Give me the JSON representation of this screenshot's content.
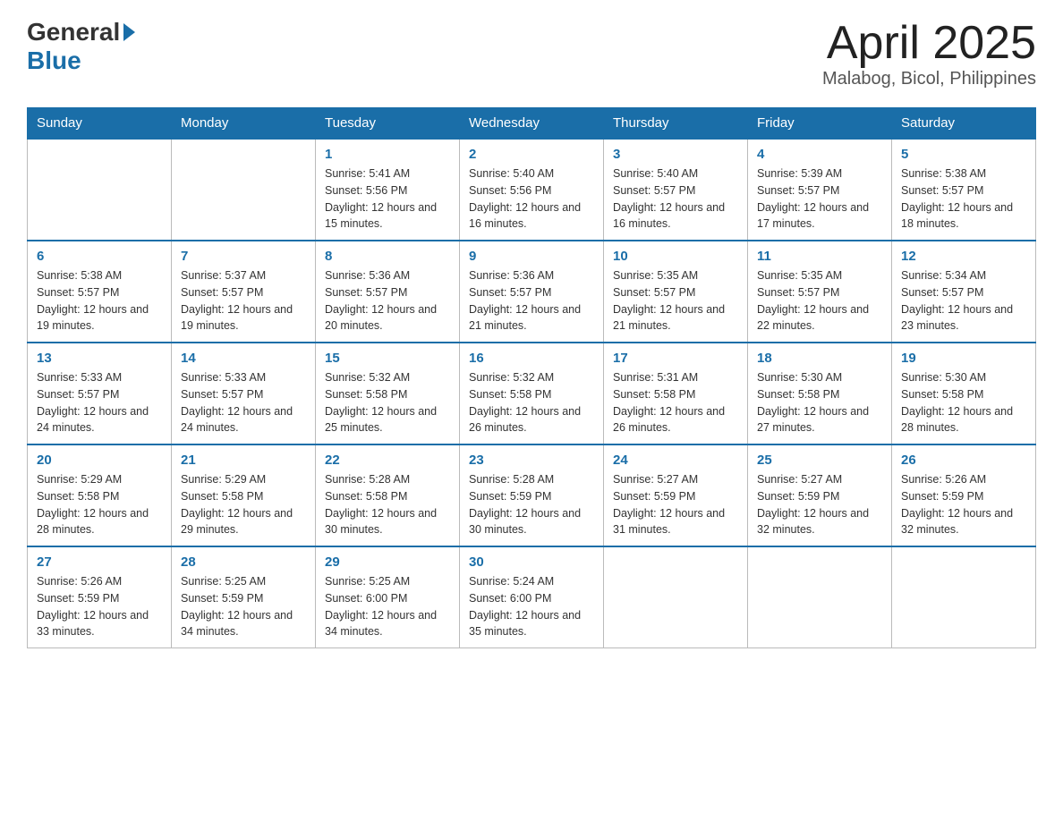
{
  "header": {
    "title": "April 2025",
    "subtitle": "Malabog, Bicol, Philippines",
    "logo_general": "General",
    "logo_blue": "Blue"
  },
  "weekdays": [
    "Sunday",
    "Monday",
    "Tuesday",
    "Wednesday",
    "Thursday",
    "Friday",
    "Saturday"
  ],
  "weeks": [
    [
      {
        "day": "",
        "sunrise": "",
        "sunset": "",
        "daylight": ""
      },
      {
        "day": "",
        "sunrise": "",
        "sunset": "",
        "daylight": ""
      },
      {
        "day": "1",
        "sunrise": "Sunrise: 5:41 AM",
        "sunset": "Sunset: 5:56 PM",
        "daylight": "Daylight: 12 hours and 15 minutes."
      },
      {
        "day": "2",
        "sunrise": "Sunrise: 5:40 AM",
        "sunset": "Sunset: 5:56 PM",
        "daylight": "Daylight: 12 hours and 16 minutes."
      },
      {
        "day": "3",
        "sunrise": "Sunrise: 5:40 AM",
        "sunset": "Sunset: 5:57 PM",
        "daylight": "Daylight: 12 hours and 16 minutes."
      },
      {
        "day": "4",
        "sunrise": "Sunrise: 5:39 AM",
        "sunset": "Sunset: 5:57 PM",
        "daylight": "Daylight: 12 hours and 17 minutes."
      },
      {
        "day": "5",
        "sunrise": "Sunrise: 5:38 AM",
        "sunset": "Sunset: 5:57 PM",
        "daylight": "Daylight: 12 hours and 18 minutes."
      }
    ],
    [
      {
        "day": "6",
        "sunrise": "Sunrise: 5:38 AM",
        "sunset": "Sunset: 5:57 PM",
        "daylight": "Daylight: 12 hours and 19 minutes."
      },
      {
        "day": "7",
        "sunrise": "Sunrise: 5:37 AM",
        "sunset": "Sunset: 5:57 PM",
        "daylight": "Daylight: 12 hours and 19 minutes."
      },
      {
        "day": "8",
        "sunrise": "Sunrise: 5:36 AM",
        "sunset": "Sunset: 5:57 PM",
        "daylight": "Daylight: 12 hours and 20 minutes."
      },
      {
        "day": "9",
        "sunrise": "Sunrise: 5:36 AM",
        "sunset": "Sunset: 5:57 PM",
        "daylight": "Daylight: 12 hours and 21 minutes."
      },
      {
        "day": "10",
        "sunrise": "Sunrise: 5:35 AM",
        "sunset": "Sunset: 5:57 PM",
        "daylight": "Daylight: 12 hours and 21 minutes."
      },
      {
        "day": "11",
        "sunrise": "Sunrise: 5:35 AM",
        "sunset": "Sunset: 5:57 PM",
        "daylight": "Daylight: 12 hours and 22 minutes."
      },
      {
        "day": "12",
        "sunrise": "Sunrise: 5:34 AM",
        "sunset": "Sunset: 5:57 PM",
        "daylight": "Daylight: 12 hours and 23 minutes."
      }
    ],
    [
      {
        "day": "13",
        "sunrise": "Sunrise: 5:33 AM",
        "sunset": "Sunset: 5:57 PM",
        "daylight": "Daylight: 12 hours and 24 minutes."
      },
      {
        "day": "14",
        "sunrise": "Sunrise: 5:33 AM",
        "sunset": "Sunset: 5:57 PM",
        "daylight": "Daylight: 12 hours and 24 minutes."
      },
      {
        "day": "15",
        "sunrise": "Sunrise: 5:32 AM",
        "sunset": "Sunset: 5:58 PM",
        "daylight": "Daylight: 12 hours and 25 minutes."
      },
      {
        "day": "16",
        "sunrise": "Sunrise: 5:32 AM",
        "sunset": "Sunset: 5:58 PM",
        "daylight": "Daylight: 12 hours and 26 minutes."
      },
      {
        "day": "17",
        "sunrise": "Sunrise: 5:31 AM",
        "sunset": "Sunset: 5:58 PM",
        "daylight": "Daylight: 12 hours and 26 minutes."
      },
      {
        "day": "18",
        "sunrise": "Sunrise: 5:30 AM",
        "sunset": "Sunset: 5:58 PM",
        "daylight": "Daylight: 12 hours and 27 minutes."
      },
      {
        "day": "19",
        "sunrise": "Sunrise: 5:30 AM",
        "sunset": "Sunset: 5:58 PM",
        "daylight": "Daylight: 12 hours and 28 minutes."
      }
    ],
    [
      {
        "day": "20",
        "sunrise": "Sunrise: 5:29 AM",
        "sunset": "Sunset: 5:58 PM",
        "daylight": "Daylight: 12 hours and 28 minutes."
      },
      {
        "day": "21",
        "sunrise": "Sunrise: 5:29 AM",
        "sunset": "Sunset: 5:58 PM",
        "daylight": "Daylight: 12 hours and 29 minutes."
      },
      {
        "day": "22",
        "sunrise": "Sunrise: 5:28 AM",
        "sunset": "Sunset: 5:58 PM",
        "daylight": "Daylight: 12 hours and 30 minutes."
      },
      {
        "day": "23",
        "sunrise": "Sunrise: 5:28 AM",
        "sunset": "Sunset: 5:59 PM",
        "daylight": "Daylight: 12 hours and 30 minutes."
      },
      {
        "day": "24",
        "sunrise": "Sunrise: 5:27 AM",
        "sunset": "Sunset: 5:59 PM",
        "daylight": "Daylight: 12 hours and 31 minutes."
      },
      {
        "day": "25",
        "sunrise": "Sunrise: 5:27 AM",
        "sunset": "Sunset: 5:59 PM",
        "daylight": "Daylight: 12 hours and 32 minutes."
      },
      {
        "day": "26",
        "sunrise": "Sunrise: 5:26 AM",
        "sunset": "Sunset: 5:59 PM",
        "daylight": "Daylight: 12 hours and 32 minutes."
      }
    ],
    [
      {
        "day": "27",
        "sunrise": "Sunrise: 5:26 AM",
        "sunset": "Sunset: 5:59 PM",
        "daylight": "Daylight: 12 hours and 33 minutes."
      },
      {
        "day": "28",
        "sunrise": "Sunrise: 5:25 AM",
        "sunset": "Sunset: 5:59 PM",
        "daylight": "Daylight: 12 hours and 34 minutes."
      },
      {
        "day": "29",
        "sunrise": "Sunrise: 5:25 AM",
        "sunset": "Sunset: 6:00 PM",
        "daylight": "Daylight: 12 hours and 34 minutes."
      },
      {
        "day": "30",
        "sunrise": "Sunrise: 5:24 AM",
        "sunset": "Sunset: 6:00 PM",
        "daylight": "Daylight: 12 hours and 35 minutes."
      },
      {
        "day": "",
        "sunrise": "",
        "sunset": "",
        "daylight": ""
      },
      {
        "day": "",
        "sunrise": "",
        "sunset": "",
        "daylight": ""
      },
      {
        "day": "",
        "sunrise": "",
        "sunset": "",
        "daylight": ""
      }
    ]
  ]
}
